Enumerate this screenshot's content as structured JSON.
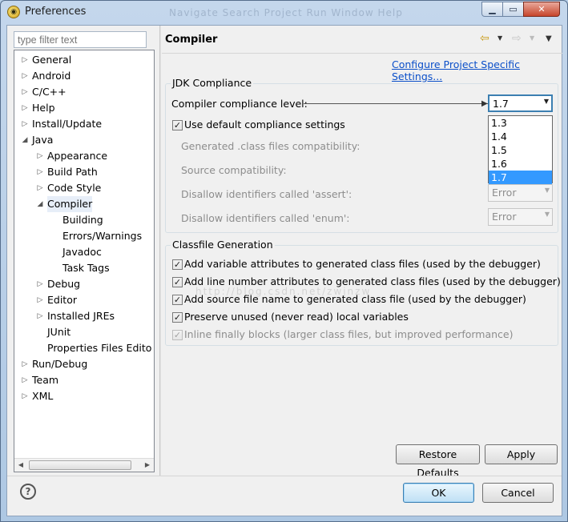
{
  "window": {
    "title": "Preferences",
    "menu_ghost": "Navigate   Search   Project   Run   Window   Help"
  },
  "filter": {
    "placeholder": "type filter text"
  },
  "tree": [
    {
      "label": "General",
      "level": 0,
      "state": "collapsed"
    },
    {
      "label": "Android",
      "level": 0,
      "state": "collapsed"
    },
    {
      "label": "C/C++",
      "level": 0,
      "state": "collapsed"
    },
    {
      "label": "Help",
      "level": 0,
      "state": "collapsed"
    },
    {
      "label": "Install/Update",
      "level": 0,
      "state": "collapsed"
    },
    {
      "label": "Java",
      "level": 0,
      "state": "expanded"
    },
    {
      "label": "Appearance",
      "level": 1,
      "state": "collapsed"
    },
    {
      "label": "Build Path",
      "level": 1,
      "state": "collapsed"
    },
    {
      "label": "Code Style",
      "level": 1,
      "state": "collapsed"
    },
    {
      "label": "Compiler",
      "level": 1,
      "state": "expanded",
      "selected": true
    },
    {
      "label": "Building",
      "level": 2,
      "state": "leaf"
    },
    {
      "label": "Errors/Warnings",
      "level": 2,
      "state": "leaf"
    },
    {
      "label": "Javadoc",
      "level": 2,
      "state": "leaf"
    },
    {
      "label": "Task Tags",
      "level": 2,
      "state": "leaf"
    },
    {
      "label": "Debug",
      "level": 1,
      "state": "collapsed"
    },
    {
      "label": "Editor",
      "level": 1,
      "state": "collapsed"
    },
    {
      "label": "Installed JREs",
      "level": 1,
      "state": "collapsed"
    },
    {
      "label": "JUnit",
      "level": 1,
      "state": "leaf"
    },
    {
      "label": "Properties Files Edito",
      "level": 1,
      "state": "leaf"
    },
    {
      "label": "Run/Debug",
      "level": 0,
      "state": "collapsed"
    },
    {
      "label": "Team",
      "level": 0,
      "state": "collapsed"
    },
    {
      "label": "XML",
      "level": 0,
      "state": "collapsed"
    }
  ],
  "page": {
    "title": "Compiler",
    "configure_link": "Configure Project Specific Settings..."
  },
  "jdk": {
    "group_label": "JDK Compliance",
    "compliance_label": "Compiler compliance level:",
    "compliance_value": "1.7",
    "options": [
      "1.3",
      "1.4",
      "1.5",
      "1.6",
      "1.7"
    ],
    "selected_option": "1.7",
    "use_default_label": "Use default compliance settings",
    "use_default_checked": true,
    "generated_label": "Generated .class files compatibility:",
    "source_label": "Source compatibility:",
    "assert_label": "Disallow identifiers called 'assert':",
    "assert_value": "Error",
    "enum_label": "Disallow identifiers called 'enum':",
    "enum_value": "Error"
  },
  "classfile": {
    "group_label": "Classfile Generation",
    "items": [
      {
        "label": "Add variable attributes to generated class files (used by the debugger)",
        "checked": true,
        "enabled": true
      },
      {
        "label": "Add line number attributes to generated class files (used by the debugger)",
        "checked": true,
        "enabled": true
      },
      {
        "label": "Add source file name to generated class file (used by the debugger)",
        "checked": true,
        "enabled": true
      },
      {
        "label": "Preserve unused (never read) local variables",
        "checked": true,
        "enabled": true
      },
      {
        "label": "Inline finally blocks (larger class files, but improved performance)",
        "checked": true,
        "enabled": false
      }
    ]
  },
  "watermark": "http://blog.csdn.net/zwjnzw",
  "buttons": {
    "restore_defaults": "Restore Defaults",
    "apply": "Apply",
    "ok": "OK",
    "cancel": "Cancel"
  },
  "icons": {
    "help": "help-icon",
    "back": "back-arrow-icon",
    "forward": "forward-arrow-icon",
    "menu": "view-menu-icon"
  }
}
